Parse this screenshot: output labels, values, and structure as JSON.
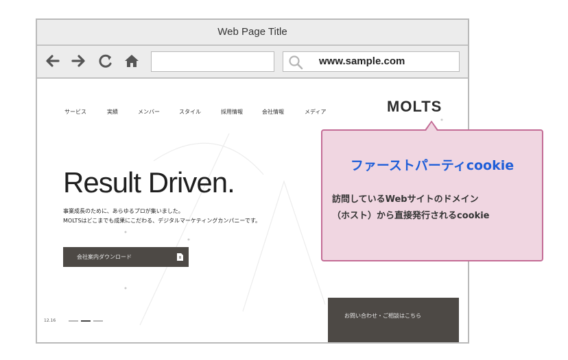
{
  "browser": {
    "title": "Web Page Title",
    "address_value": "",
    "search_value": "www.sample.com",
    "icons": [
      "back-arrow-icon",
      "forward-arrow-icon",
      "reload-icon",
      "home-icon",
      "search-icon"
    ]
  },
  "site": {
    "nav": [
      "サービス",
      "実績",
      "メンバー",
      "スタイル",
      "採用情報",
      "会社情報",
      "メディア"
    ],
    "logo": "MOLTS",
    "hero_title": "Result Driven.",
    "hero_sub1": "事業成長のために、あらゆるプロが集いました。",
    "hero_sub2": "MOLTSはどこまでも成果にこだわる、デジタルマーケティングカンパニーです。",
    "download_button": "会社案内ダウンロード",
    "contact_button": "お問い合わせ・ご相談はこちら",
    "slide_number": "12.16"
  },
  "callout": {
    "title": "ファーストパーティcookie",
    "line1": "訪問しているWebサイトのドメイン",
    "line2": "（ホスト）から直接発行されるcookie"
  },
  "colors": {
    "callout_bg": "#f0d6e1",
    "callout_border": "#c36b95",
    "callout_title": "#1f5ed8",
    "button_dark": "#4d4945"
  }
}
